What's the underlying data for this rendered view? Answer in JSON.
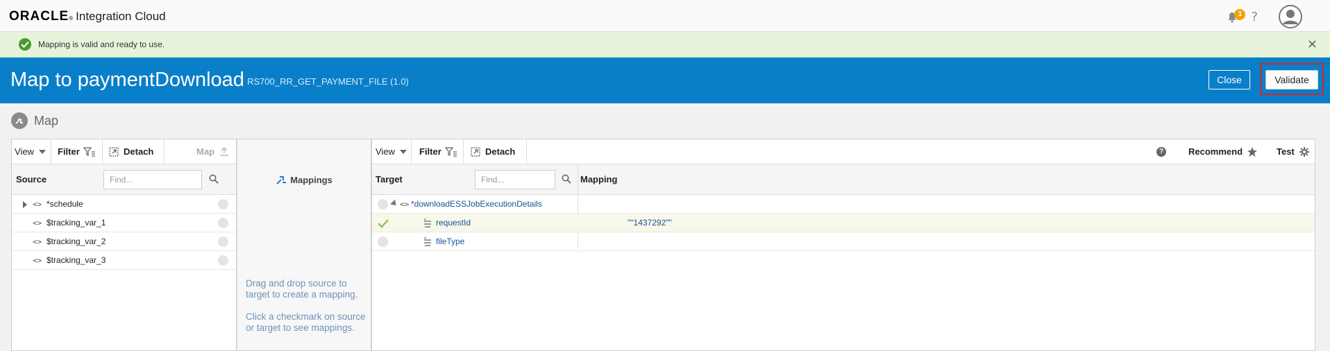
{
  "topbar": {
    "brand": "ORACLE",
    "brand_reg": "®",
    "product": "Integration Cloud",
    "notification_count": "1",
    "help": "?"
  },
  "banner": {
    "message": "Mapping is valid and ready to use.",
    "close": "×"
  },
  "header": {
    "title": "Map to paymentDownload",
    "subtitle": "RS700_RR_GET_PAYMENT_FILE (1.0)",
    "close_label": "Close",
    "validate_label": "Validate"
  },
  "map_section": {
    "label": "Map"
  },
  "source_panel": {
    "toolbar": {
      "view": "View",
      "filter": "Filter",
      "detach": "Detach",
      "map": "Map"
    },
    "column_label": "Source",
    "find_placeholder": "Find...",
    "rows": [
      {
        "label": "*schedule",
        "expandable": true
      },
      {
        "label": "$tracking_var_1",
        "expandable": false
      },
      {
        "label": "$tracking_var_2",
        "expandable": false
      },
      {
        "label": "$tracking_var_3",
        "expandable": false
      }
    ]
  },
  "mappings_panel": {
    "title": "Mappings",
    "help_1": "Drag and drop source to target to create a mapping.",
    "help_2": "Click a checkmark on source or target to see mappings."
  },
  "target_panel": {
    "toolbar": {
      "view": "View",
      "filter": "Filter",
      "detach": "Detach",
      "help": "?",
      "recommend": "Recommend",
      "test": "Test"
    },
    "column_target": "Target",
    "column_mapping": "Mapping",
    "find_placeholder": "Find...",
    "rows": [
      {
        "label": "*downloadESSJobExecutionDetails",
        "mapping": "",
        "mapped": false
      },
      {
        "label": "requestId",
        "mapping": "\"\"1437292\"\"",
        "mapped": true
      },
      {
        "label": "fileType",
        "mapping": "",
        "mapped": false
      }
    ]
  },
  "colors": {
    "header_blue": "#0a7fc9",
    "banner_green": "#e6f4dc",
    "validate_highlight": "#d9202a",
    "link_blue": "#1a4f9c"
  }
}
